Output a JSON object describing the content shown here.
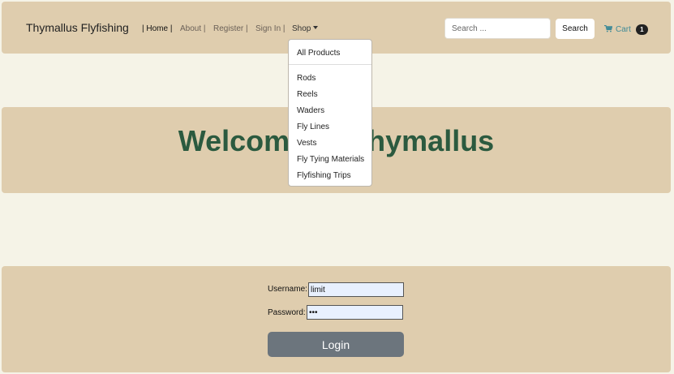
{
  "navbar": {
    "brand": "Thymallus Flyfishing",
    "links": [
      {
        "label": "| Home |"
      },
      {
        "label": "About |"
      },
      {
        "label": "Register |"
      },
      {
        "label": "Sign In |"
      },
      {
        "label": "Shop"
      }
    ],
    "search": {
      "placeholder": "Search ...",
      "button_label": "Search"
    },
    "cart": {
      "label": "Cart",
      "count": "1"
    }
  },
  "shop_menu": {
    "items": [
      "All Products",
      "Rods",
      "Reels",
      "Waders",
      "Fly Lines",
      "Vests",
      "Fly Tying Materials",
      "Flyfishing Trips"
    ]
  },
  "hero": {
    "title": "Welcome to Thymallus"
  },
  "login": {
    "username_label": "Username:",
    "username_value": "limit",
    "password_label": "Password:",
    "password_value": "•••",
    "button_label": "Login"
  },
  "colors": {
    "page_background": "#f5f3e7",
    "panel_background": "#dfcdae",
    "heading": "#2b5a3f",
    "cart_accent": "#3f8a97",
    "login_button": "#6c757d"
  }
}
